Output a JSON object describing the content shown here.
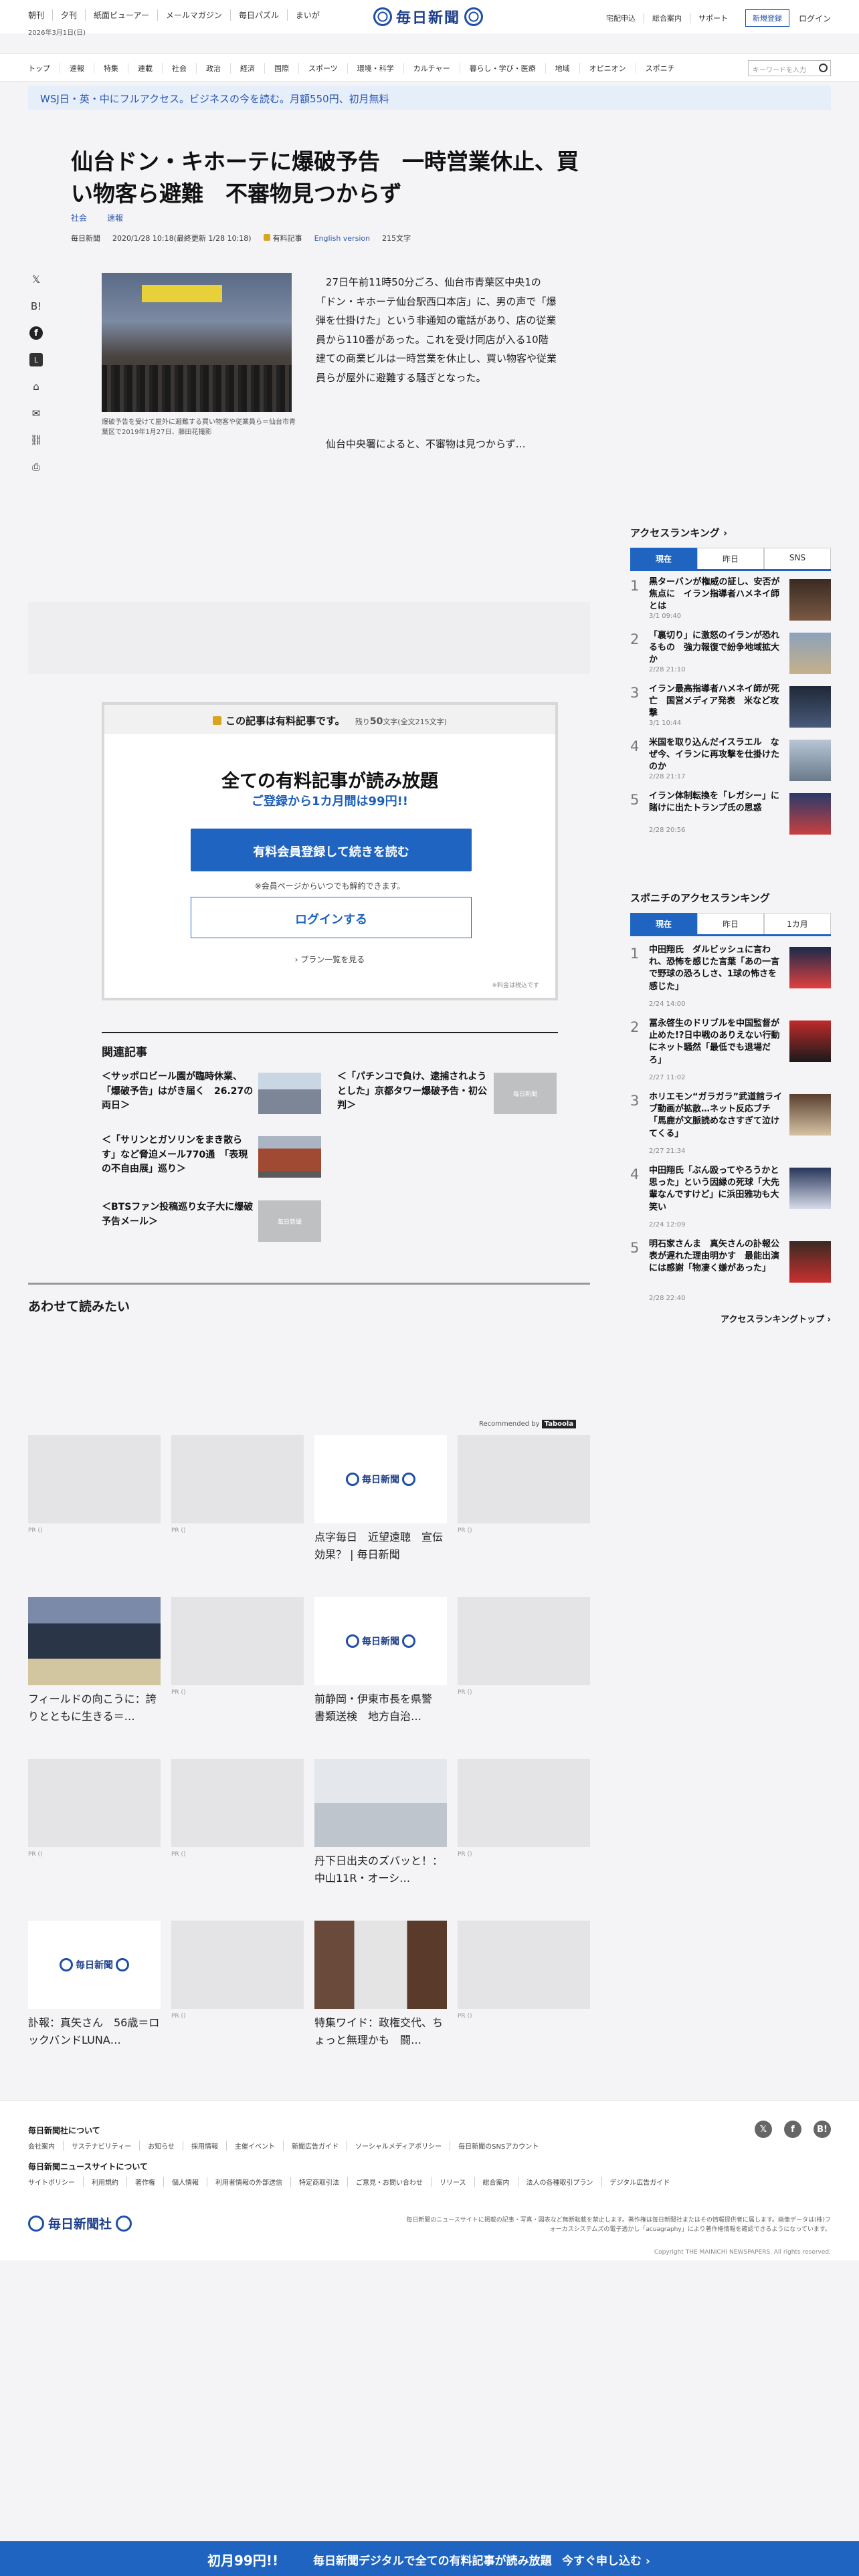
{
  "header": {
    "links": [
      "朝刊",
      "夕刊",
      "紙面ビューアー",
      "メールマガジン",
      "毎日パズル",
      "まいが"
    ],
    "date": "2026年3月1日(日)",
    "logo_text": "毎日新聞",
    "right_links": [
      "宅配申込",
      "総合案内",
      "サポート"
    ],
    "register": "新規登録",
    "login": "ログイン"
  },
  "nav": {
    "items": [
      "トップ",
      "速報",
      "特集",
      "連載",
      "社会",
      "政治",
      "経済",
      "国際",
      "スポーツ",
      "環境・科学",
      "カルチャー",
      "暮らし・学び・医療",
      "地域",
      "オピニオン",
      "スポニチ"
    ],
    "search_placeholder": "キーワードを入力"
  },
  "banner": "WSJ日・英・中にフルアクセス。ビジネスの今を読む。月額550円、初月無料",
  "article": {
    "title": "仙台ドン・キホーテに爆破予告　一時営業休止、買い物客ら避難　不審物見つからず",
    "tags": [
      "社会",
      "速報"
    ],
    "source": "毎日新聞",
    "datetime": "2020/1/28 10:18(最終更新 1/28 10:18)",
    "paid_label": "有料記事",
    "english": "English version",
    "chars": "215文字",
    "caption": "爆破予告を受けて屋外に避難する買い物客や従業員ら＝仙台市青葉区で2019年1月27日、藤田花撮影",
    "p1": "27日午前11時50分ごろ、仙台市青葉区中央1の「ドン・キホーテ仙台駅西口本店」に、男の声で「爆弾を仕掛けた」という非通知の電話があり、店の従業員から110番があった。これを受け同店が入る10階建ての商業ビルは一時営業を休止し、買い物客や従業員らが屋外に避難する騒ぎとなった。",
    "p2": "仙台中央署によると、不審物は見つからず…"
  },
  "share": {
    "icons": [
      "x-icon",
      "hatena-icon",
      "facebook-icon",
      "line-icon",
      "bookmark-icon",
      "mail-icon",
      "link-icon",
      "print-icon"
    ],
    "glyphs": [
      "𝕏",
      "B!",
      "f",
      "L",
      "⌂",
      "✉",
      "⛓",
      "⎙"
    ]
  },
  "paywall": {
    "head": "この記事は有料記事です。",
    "remain_prefix": "残り",
    "remain": "50",
    "remain_suffix": "文字(全文215文字)",
    "main": "全ての有料記事が読み放題",
    "sub": "ご登録から1カ月間は99円!!",
    "btn_register": "有料会員登録して続きを読む",
    "note": "※会員ページからいつでも解約できます。",
    "btn_login": "ログインする",
    "plans": "プラン一覧を見る",
    "tax": "※料金は税込です"
  },
  "related": {
    "heading": "関連記事",
    "items": [
      "＜サッポロビール園が臨時休業、「爆破予告」はがき届く　26.27の両日＞",
      "＜「パチンコで負け、逮捕されようとした」京都タワー爆破予告・初公判＞",
      "＜「サリンとガソリンをまき散らす」など脅迫メール770通　「表現の不自由展」巡り＞",
      "＜BTSファン投稿巡り女子大に爆破予告メール＞"
    ],
    "placeholder": "毎日新聞"
  },
  "also_read": {
    "heading": "あわせて読みたい",
    "recommended": "Recommended by",
    "brand": "Taboola",
    "pr": "PR ()",
    "tile_titles": [
      "点字毎日　近望遠聴　宣伝効果？ | 毎日新聞",
      "フィールドの向こうに：誇りとともに生きる＝…",
      "前静岡・伊東市長を県警　書類送検　地方自治…",
      "丹下日出夫のズバッと！：中山11R・オーシ…",
      "訃報：真矢さん　56歳＝ロックバンドLUNA…",
      "特集ワイド：政権交代、ちょっと無理かも　闘…"
    ]
  },
  "sidebar": {
    "ranking_title": "アクセスランキング",
    "tabs": [
      "現在",
      "昨日",
      "SNS"
    ],
    "ranks": [
      {
        "n": "1",
        "t": "黒ターバンが権威の証し、安否が焦点に　イラン指導者ハメネイ師とは",
        "d": "3/1 09:40"
      },
      {
        "n": "2",
        "t": "「裏切り」に激怒のイランが恐れるもの　強力報復で紛争地域拡大か",
        "d": "2/28 21:10"
      },
      {
        "n": "3",
        "t": "イラン最高指導者ハメネイ師が死亡　国営メディア発表　米など攻撃",
        "d": "3/1 10:44"
      },
      {
        "n": "4",
        "t": "米国を取り込んだイスラエル　なぜ今、イランに再攻撃を仕掛けたのか",
        "d": "2/28 21:17"
      },
      {
        "n": "5",
        "t": "イラン体制転換を「レガシー」に賭けに出たトランプ氏の思惑",
        "d": "2/28 20:56"
      }
    ],
    "sponichi_title": "スポニチのアクセスランキング",
    "sponichi_tabs": [
      "現在",
      "昨日",
      "1カ月"
    ],
    "sponichi": [
      {
        "n": "1",
        "t": "中田翔氏　ダルビッシュに言われ、恐怖を感じた言葉「あの一言で野球の恐ろしさ、1球の怖さを感じた」",
        "d": "2/24 14:00"
      },
      {
        "n": "2",
        "t": "冨永啓生のドリブルを中国監督が止めた!?日中戦のありえない行動にネット騒然「最低でも退場だろ」",
        "d": "2/27 11:02"
      },
      {
        "n": "3",
        "t": "ホリエモン“ガラガラ”武道館ライブ動画が拡散…ネット反応ブチ「馬鹿が文脈読めなさすぎて泣けてくる」",
        "d": "2/27 21:34"
      },
      {
        "n": "4",
        "t": "中田翔氏「ぶん殴ってやろうかと思った」という因縁の死球「大先輩なんですけど」に浜田雅功も大笑い",
        "d": "2/24 12:09"
      },
      {
        "n": "5",
        "t": "明石家さんま　真矢さんの訃報公表が遅れた理由明かす　最能出演には感謝「物凄く嫌があった」",
        "d": "2/28 22:40"
      }
    ],
    "more": "アクセスランキングトップ"
  },
  "footer": {
    "about_title": "毎日新聞社について",
    "about_links": [
      "会社案内",
      "サステナビリティー",
      "お知らせ",
      "採用情報",
      "主催イベント",
      "新聞広告ガイド",
      "ソーシャルメディアポリシー",
      "毎日新聞のSNSアカウント"
    ],
    "site_title": "毎日新聞ニュースサイトについて",
    "site_links": [
      "サイトポリシー",
      "利用規約",
      "著作権",
      "個人情報",
      "利用者情報の外部送信",
      "特定商取引法",
      "ご意見・お問い合わせ",
      "リリース",
      "総合案内",
      "法人の各種取引プラン",
      "デジタル広告ガイド"
    ],
    "logo": "毎日新聞社",
    "note": "毎日新聞のニュースサイトに掲載の記事・写真・図表など無断転載を禁止します。著作権は毎日新聞社またはその情報提供者に属します。画像データは(株)フォーカスシステムズの電子透かし「acuagraphy」により著作権情報を確認できるようになっています。",
    "copyright": "Copyright THE MAINICHI NEWSPAPERS. All rights reserved."
  },
  "cta": {
    "price": "初月99円!!",
    "text": "毎日新聞デジタルで全ての有料記事が読み放題",
    "apply": "今すぐ申し込む ›"
  },
  "colors": {
    "accent": "#1e64c0",
    "brand": "#1e3f8a",
    "lock": "#d8a520"
  }
}
